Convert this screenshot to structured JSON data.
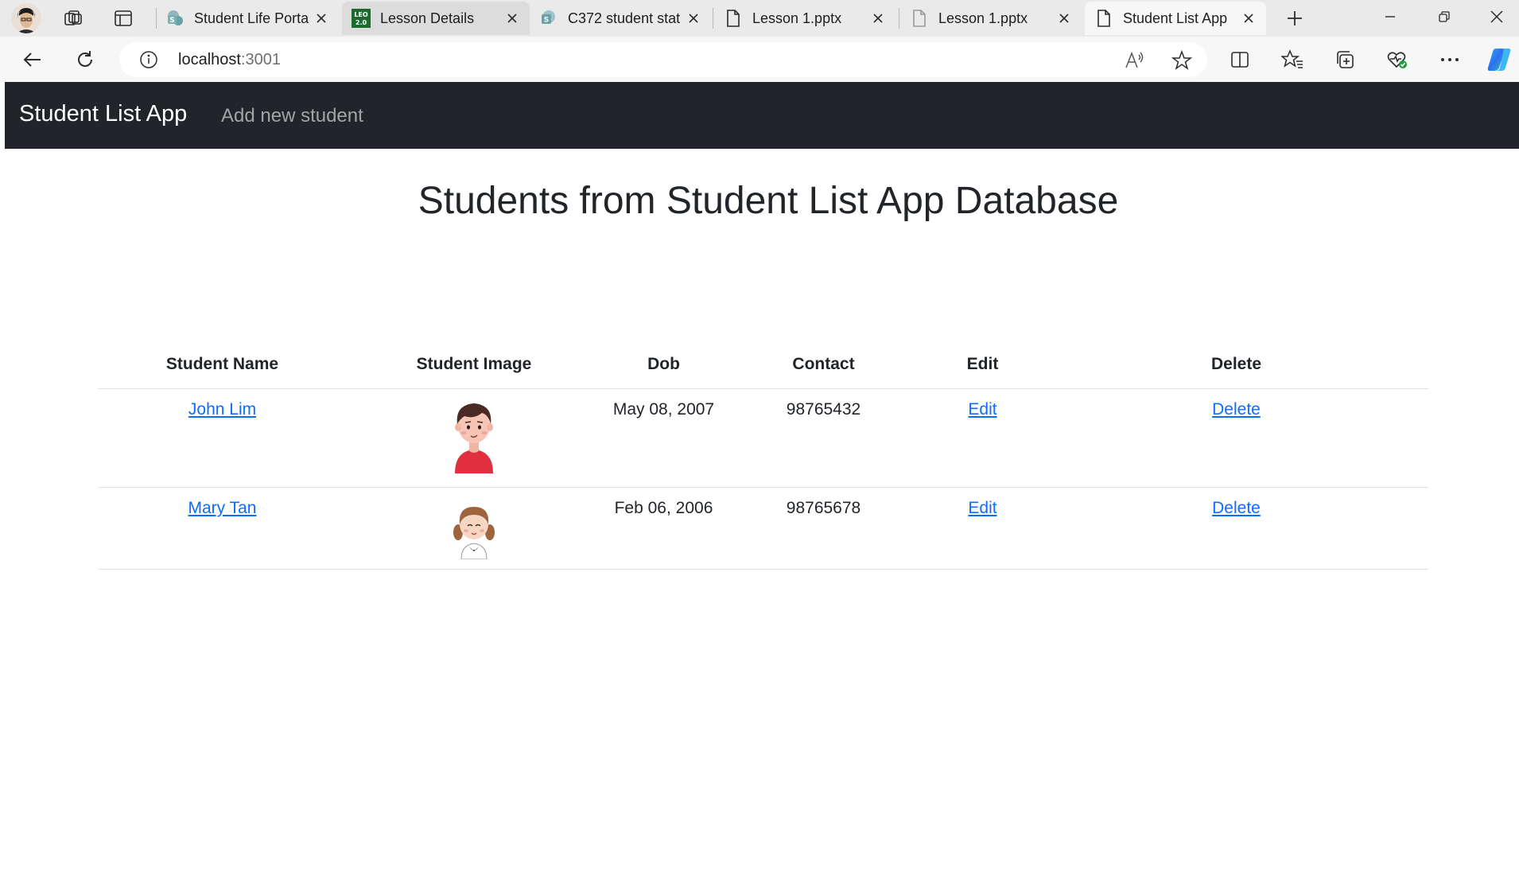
{
  "browser": {
    "tabs": [
      {
        "title": "Student Life Porta",
        "icon": "sharepoint-icon"
      },
      {
        "title": "Lesson Details",
        "icon": "leo-icon"
      },
      {
        "title": "C372 student stat",
        "icon": "sharepoint-icon"
      },
      {
        "title": "Lesson 1.pptx",
        "icon": "document-icon"
      },
      {
        "title": "Lesson 1.pptx",
        "icon": "document-icon"
      },
      {
        "title": "Student List App",
        "icon": "document-icon",
        "active": true
      }
    ],
    "leo_badge": [
      "LEO",
      "2.0"
    ],
    "url_host": "localhost",
    "url_port": ":3001"
  },
  "navbar": {
    "brand": "Student List App",
    "add_link": "Add new student"
  },
  "page": {
    "title": "Students from Student List App Database"
  },
  "table": {
    "headers": {
      "name": "Student Name",
      "image": "Student Image",
      "dob": "Dob",
      "contact": "Contact",
      "edit": "Edit",
      "delete": "Delete"
    },
    "rows": [
      {
        "name": "John Lim",
        "image": "boy-avatar",
        "dob": "May 08, 2007",
        "contact": "98765432",
        "edit": "Edit",
        "delete": "Delete"
      },
      {
        "name": "Mary Tan",
        "image": "girl-avatar",
        "dob": "Feb 06, 2006",
        "contact": "98765678",
        "edit": "Edit",
        "delete": "Delete"
      }
    ]
  },
  "colors": {
    "navbar_bg": "#212529",
    "link": "#0d6efd",
    "tabstrip_bg": "#eaeaea",
    "active_tab_bg": "#f7f7f7"
  }
}
